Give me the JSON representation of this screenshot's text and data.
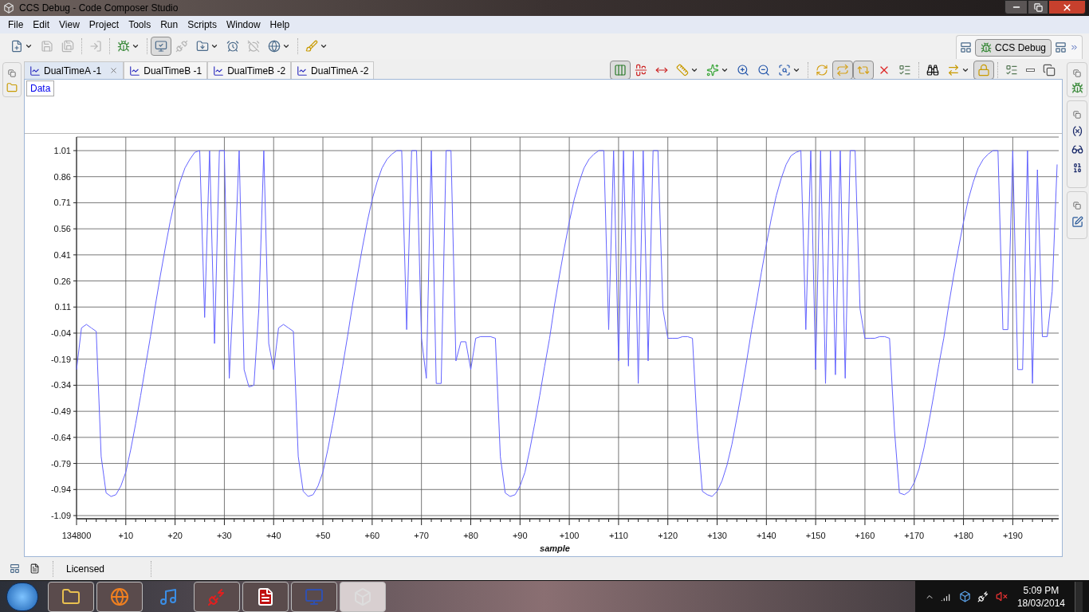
{
  "window": {
    "title": "CCS Debug - Code Composer Studio"
  },
  "menu": [
    "File",
    "Edit",
    "View",
    "Project",
    "Tools",
    "Run",
    "Scripts",
    "Window",
    "Help"
  ],
  "toolbar": [
    {
      "disabled": false,
      "pressed": false,
      "dropdown": true
    },
    {
      "disabled": true,
      "pressed": false,
      "dropdown": false
    },
    {
      "disabled": true,
      "pressed": false,
      "dropdown": false
    },
    {
      "disabled": true,
      "pressed": false,
      "dropdown": false
    },
    {
      "disabled": false,
      "pressed": false,
      "dropdown": true
    },
    {
      "disabled": false,
      "pressed": true,
      "dropdown": false
    },
    {
      "disabled": true,
      "pressed": false,
      "dropdown": false
    },
    {
      "disabled": false,
      "pressed": false,
      "dropdown": true
    },
    {
      "disabled": false,
      "pressed": false,
      "dropdown": false
    },
    {
      "disabled": true,
      "pressed": false,
      "dropdown": false
    },
    {
      "disabled": false,
      "pressed": false,
      "dropdown": true
    },
    {
      "disabled": false,
      "pressed": false,
      "dropdown": true
    }
  ],
  "perspective": {
    "label": "CCS Debug",
    "selected": true
  },
  "editor_tabs": [
    {
      "label": "DualTimeA -1",
      "selected": true
    },
    {
      "label": "DualTimeB -1",
      "selected": false
    },
    {
      "label": "DualTimeB -2",
      "selected": false
    },
    {
      "label": "DualTimeA -2",
      "selected": false
    }
  ],
  "graph_toolbar": [
    {
      "pressed": true,
      "dropdown": false
    },
    {
      "pressed": false,
      "dropdown": false
    },
    {
      "pressed": false,
      "dropdown": false
    },
    {
      "pressed": false,
      "dropdown": true
    },
    {
      "pressed": false,
      "dropdown": true
    },
    {
      "pressed": false,
      "dropdown": false
    },
    {
      "pressed": false,
      "dropdown": false
    },
    {
      "pressed": false,
      "dropdown": true
    },
    {
      "pressed": false,
      "dropdown": false
    },
    {
      "pressed": true,
      "dropdown": false
    },
    {
      "pressed": true,
      "dropdown": false
    },
    {
      "pressed": false,
      "dropdown": false
    },
    {
      "pressed": false,
      "dropdown": false
    },
    {
      "pressed": false,
      "dropdown": false
    },
    {
      "pressed": false,
      "dropdown": true
    },
    {
      "pressed": true,
      "dropdown": false
    },
    {
      "pressed": false,
      "dropdown": false
    },
    {
      "pressed": false,
      "dropdown": false
    },
    {
      "pressed": false,
      "dropdown": false
    }
  ],
  "view_tabs": [
    {
      "label": "Data",
      "selected": true
    }
  ],
  "chart": {
    "chart_data": {
      "type": "line",
      "xlabel": "sample",
      "grid": true,
      "categories": [
        "134800",
        null,
        null,
        null,
        null,
        null,
        null,
        null,
        null,
        null,
        "+10",
        null,
        null,
        null,
        null,
        null,
        null,
        null,
        null,
        null,
        "+20",
        null,
        null,
        null,
        null,
        null,
        null,
        null,
        null,
        null,
        "+30",
        null,
        null,
        null,
        null,
        null,
        null,
        null,
        null,
        null,
        "+40",
        null,
        null,
        null,
        null,
        null,
        null,
        null,
        null,
        null,
        "+50",
        null,
        null,
        null,
        null,
        null,
        null,
        null,
        null,
        null,
        "+60",
        null,
        null,
        null,
        null,
        null,
        null,
        null,
        null,
        null,
        "+70",
        null,
        null,
        null,
        null,
        null,
        null,
        null,
        null,
        null,
        "+80",
        null,
        null,
        null,
        null,
        null,
        null,
        null,
        null,
        null,
        "+90",
        null,
        null,
        null,
        null,
        null,
        null,
        null,
        null,
        null,
        "+100",
        null,
        null,
        null,
        null,
        null,
        null,
        null,
        null,
        null,
        "+110",
        null,
        null,
        null,
        null,
        null,
        null,
        null,
        null,
        null,
        "+120",
        null,
        null,
        null,
        null,
        null,
        null,
        null,
        null,
        null,
        "+130",
        null,
        null,
        null,
        null,
        null,
        null,
        null,
        null,
        null,
        "+140",
        null,
        null,
        null,
        null,
        null,
        null,
        null,
        null,
        null,
        "+150",
        null,
        null,
        null,
        null,
        null,
        null,
        null,
        null,
        null,
        "+160",
        null,
        null,
        null,
        null,
        null,
        null,
        null,
        null,
        null,
        "+170",
        null,
        null,
        null,
        null,
        null,
        null,
        null,
        null,
        null,
        "+180",
        null,
        null,
        null,
        null,
        null,
        null,
        null,
        null,
        null,
        "+190",
        null,
        null,
        null,
        null,
        null,
        null,
        null,
        null,
        null
      ],
      "ylim": [
        -1.09,
        1.01
      ],
      "yticks": [
        {
          "value": 1.01,
          "label": "1.01"
        },
        {
          "value": 0.86,
          "label": "0.86"
        },
        {
          "value": 0.71,
          "label": "0.71"
        },
        {
          "value": 0.56,
          "label": "0.56"
        },
        {
          "value": 0.41,
          "label": "0.41"
        },
        {
          "value": 0.26,
          "label": "0.26"
        },
        {
          "value": 0.11,
          "label": "0.11"
        },
        {
          "value": -0.04,
          "label": "-0.04"
        },
        {
          "value": -0.19,
          "label": "-0.19"
        },
        {
          "value": -0.34,
          "label": "-0.34"
        },
        {
          "value": -0.49,
          "label": "-0.49"
        },
        {
          "value": -0.64,
          "label": "-0.64"
        },
        {
          "value": -0.79,
          "label": "-0.79"
        },
        {
          "value": -0.94,
          "label": "-0.94"
        },
        {
          "value": -1.09,
          "label": "-1.09"
        }
      ],
      "series": [
        {
          "color": "#6464ff",
          "values": [
            -0.25,
            -0.01,
            0.01,
            -0.01,
            -0.03,
            -0.75,
            -0.96,
            -0.98,
            -0.97,
            -0.92,
            -0.84,
            -0.71,
            -0.56,
            -0.4,
            -0.23,
            -0.06,
            0.12,
            0.29,
            0.45,
            0.6,
            0.73,
            0.83,
            0.91,
            0.96,
            1.0,
            1.01,
            0.05,
            1.01,
            -0.1,
            1.01,
            1.01,
            -0.3,
            0.3,
            1.01,
            -0.25,
            -0.35,
            -0.34,
            0.1,
            1.01,
            -0.1,
            -0.25,
            -0.01,
            0.01,
            -0.01,
            -0.03,
            -0.75,
            -0.95,
            -0.98,
            -0.97,
            -0.92,
            -0.84,
            -0.71,
            -0.56,
            -0.4,
            -0.23,
            -0.06,
            0.12,
            0.29,
            0.45,
            0.6,
            0.73,
            0.83,
            0.91,
            0.96,
            0.99,
            1.01,
            1.01,
            -0.02,
            1.01,
            1.01,
            -0.07,
            -0.3,
            1.01,
            -0.33,
            -0.33,
            1.01,
            1.01,
            -0.2,
            -0.09,
            -0.09,
            -0.25,
            -0.07,
            -0.06,
            -0.06,
            -0.06,
            -0.07,
            -0.75,
            -0.96,
            -0.98,
            -0.97,
            -0.92,
            -0.84,
            -0.71,
            -0.56,
            -0.4,
            -0.23,
            -0.07,
            0.12,
            0.29,
            0.45,
            0.6,
            0.73,
            0.83,
            0.91,
            0.96,
            0.99,
            1.01,
            1.01,
            -0.02,
            1.01,
            -0.2,
            1.01,
            -0.23,
            1.01,
            -0.33,
            1.01,
            -0.2,
            1.01,
            1.01,
            0.1,
            -0.07,
            -0.07,
            -0.07,
            -0.06,
            -0.06,
            -0.07,
            -0.6,
            -0.95,
            -0.97,
            -0.98,
            -0.95,
            -0.89,
            -0.8,
            -0.68,
            -0.53,
            -0.37,
            -0.2,
            -0.02,
            0.14,
            0.31,
            0.47,
            0.62,
            0.75,
            0.85,
            0.93,
            0.98,
            1.0,
            1.01,
            -0.02,
            1.01,
            -0.25,
            1.01,
            -0.33,
            1.01,
            -0.28,
            1.01,
            -0.3,
            1.01,
            1.01,
            0.1,
            -0.07,
            -0.07,
            -0.07,
            -0.06,
            -0.06,
            -0.07,
            -0.6,
            -0.96,
            -0.97,
            -0.95,
            -0.9,
            -0.82,
            -0.7,
            -0.55,
            -0.39,
            -0.22,
            -0.07,
            0.12,
            0.29,
            0.45,
            0.6,
            0.73,
            0.83,
            0.91,
            0.96,
            0.99,
            1.01,
            1.01,
            -0.02,
            -0.02,
            1.01,
            -0.25,
            -0.25,
            1.01,
            -0.33,
            0.9,
            -0.06,
            -0.06,
            0.2,
            0.93
          ]
        }
      ]
    }
  },
  "status_bar": {
    "text": "Licensed"
  },
  "taskbar": {
    "apps": [
      {
        "running": true,
        "active": false
      },
      {
        "running": true,
        "active": false
      },
      {
        "running": false,
        "active": false
      },
      {
        "running": true,
        "active": false
      },
      {
        "running": true,
        "active": false
      },
      {
        "running": true,
        "active": false
      },
      {
        "running": true,
        "active": true
      }
    ],
    "clock": {
      "time": "5:09 PM",
      "date": "18/03/2014"
    }
  }
}
